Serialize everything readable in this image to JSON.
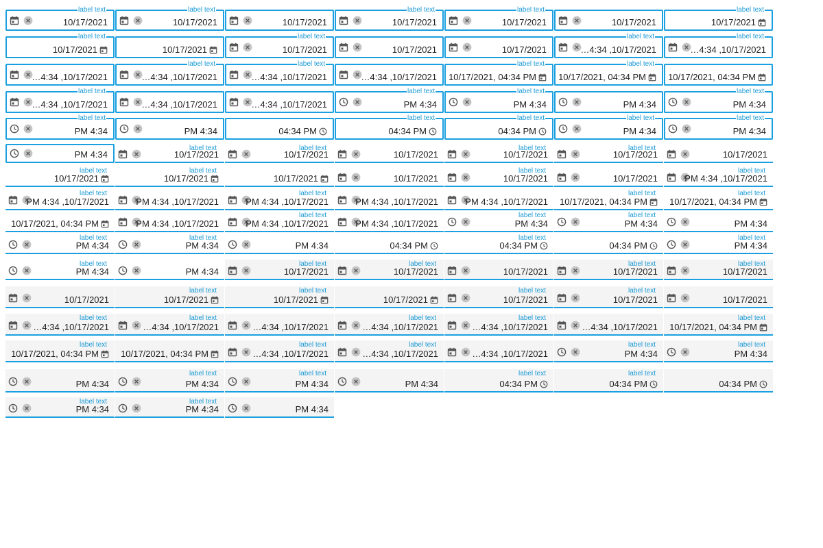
{
  "label": "label text",
  "values": {
    "date": "10/17/2021",
    "datetime_trunc": "…4:34 ,10/17/2021",
    "datetime_full": "10/17/2021, 04:34 PM",
    "datetime_rtl": "PM 4:34 ,10/17/2021",
    "time_rtl": "PM 4:34",
    "time": "04:34 PM"
  },
  "colors": {
    "accent": "#1aa0e0",
    "label": "#1a9ad6",
    "filled_bg": "#f4f4f4",
    "icon": "#555555",
    "clear_bg": "#bdbdbd"
  },
  "icons": {
    "date": "calendar-icon",
    "time": "clock-icon",
    "clear": "clear-icon"
  },
  "fields": [
    {
      "style": "outline",
      "lead": "date",
      "clear": true,
      "value": "date",
      "label": true
    },
    {
      "style": "outline",
      "lead": "date",
      "clear": true,
      "value": "date",
      "label": true
    },
    {
      "style": "outline",
      "lead": "date",
      "clear": true,
      "value": "date",
      "label": false
    },
    {
      "style": "outline",
      "lead": "date",
      "clear": true,
      "value": "date",
      "label": true
    },
    {
      "style": "outline",
      "lead": "date",
      "clear": true,
      "value": "date",
      "label": true
    },
    {
      "style": "outline",
      "lead": "date",
      "clear": true,
      "value": "date",
      "label": false
    },
    {
      "style": "outline",
      "trail": "date",
      "value": "date",
      "label": true
    },
    {
      "style": "outline",
      "trail": "date",
      "value": "date",
      "label": true
    },
    {
      "style": "outline",
      "trail": "date",
      "value": "date",
      "label": false
    },
    {
      "style": "outline",
      "lead": "date",
      "clear": true,
      "value": "date",
      "label": true
    },
    {
      "style": "outline",
      "lead": "date",
      "clear": true,
      "value": "date",
      "label": false
    },
    {
      "style": "outline",
      "lead": "date",
      "clear": true,
      "value": "date",
      "label": false
    },
    {
      "style": "outline",
      "lead": "date",
      "clear": true,
      "value": "datetime_trunc",
      "label": true
    },
    {
      "style": "outline",
      "lead": "date",
      "clear": true,
      "value": "datetime_trunc",
      "label": true
    },
    {
      "style": "outline",
      "lead": "date",
      "clear": true,
      "value": "datetime_trunc",
      "label": false
    },
    {
      "style": "outline",
      "lead": "date",
      "clear": true,
      "value": "datetime_trunc",
      "label": true
    },
    {
      "style": "outline",
      "lead": "date",
      "clear": true,
      "value": "datetime_trunc",
      "label": true
    },
    {
      "style": "outline",
      "lead": "date",
      "clear": true,
      "value": "datetime_trunc",
      "label": false
    },
    {
      "style": "outline",
      "trail": "date",
      "value": "datetime_full",
      "label": true
    },
    {
      "style": "outline",
      "trail": "date",
      "value": "datetime_full",
      "label": true
    },
    {
      "style": "outline",
      "trail": "date",
      "value": "datetime_full",
      "label": false
    },
    {
      "style": "outline",
      "lead": "date",
      "clear": true,
      "value": "datetime_trunc",
      "label": true
    },
    {
      "style": "outline",
      "lead": "date",
      "clear": true,
      "value": "datetime_trunc",
      "label": false
    },
    {
      "style": "outline",
      "lead": "date",
      "clear": true,
      "value": "datetime_trunc",
      "label": false
    },
    {
      "style": "outline",
      "lead": "time",
      "clear": true,
      "value": "time_rtl",
      "label": true
    },
    {
      "style": "outline",
      "lead": "time",
      "clear": true,
      "value": "time_rtl",
      "label": true
    },
    {
      "style": "outline",
      "lead": "time",
      "clear": true,
      "value": "time_rtl",
      "label": false
    },
    {
      "style": "outline",
      "lead": "time",
      "clear": true,
      "value": "time_rtl",
      "label": true
    },
    {
      "style": "outline",
      "lead": "time",
      "clear": true,
      "value": "time_rtl",
      "label": true
    },
    {
      "style": "outline",
      "lead": "time",
      "clear": true,
      "value": "time_rtl",
      "label": false
    },
    {
      "style": "outline",
      "trail": "time",
      "value": "time",
      "label": false
    },
    {
      "style": "outline",
      "trail": "time",
      "value": "time",
      "label": true
    },
    {
      "style": "outline",
      "trail": "time",
      "value": "time",
      "label": true
    },
    {
      "style": "outline",
      "lead": "time",
      "clear": true,
      "value": "time_rtl",
      "label": true
    },
    {
      "style": "outline",
      "lead": "time",
      "clear": true,
      "value": "time_rtl",
      "label": true
    },
    {
      "style": "outline",
      "lead": "time",
      "clear": true,
      "value": "time_rtl",
      "label": false
    },
    {
      "style": "underline",
      "lead": "date",
      "clear": true,
      "value": "date",
      "label": true
    },
    {
      "style": "underline",
      "lead": "date",
      "clear": true,
      "value": "date",
      "label": true
    },
    {
      "style": "underline",
      "lead": "date",
      "clear": true,
      "value": "date",
      "label": false
    },
    {
      "style": "underline",
      "lead": "date",
      "clear": true,
      "value": "date",
      "label": true
    },
    {
      "style": "underline",
      "lead": "date",
      "clear": true,
      "value": "date",
      "label": true
    },
    {
      "style": "underline",
      "lead": "date",
      "clear": true,
      "value": "date",
      "label": false
    },
    {
      "style": "underline",
      "trail": "date",
      "value": "date",
      "label": true
    },
    {
      "style": "underline",
      "trail": "date",
      "value": "date",
      "label": true
    },
    {
      "style": "underline",
      "trail": "date",
      "value": "date",
      "label": false
    },
    {
      "style": "underline",
      "lead": "date",
      "clear": true,
      "value": "date",
      "label": false
    },
    {
      "style": "underline",
      "lead": "date",
      "clear": true,
      "value": "date",
      "label": true
    },
    {
      "style": "underline",
      "lead": "date",
      "clear": true,
      "value": "date",
      "label": false
    },
    {
      "style": "underline",
      "lead": "date",
      "clear": true,
      "value": "datetime_rtl",
      "label": true
    },
    {
      "style": "underline",
      "lead": "date",
      "clear": true,
      "value": "datetime_rtl",
      "label": true
    },
    {
      "style": "underline",
      "lead": "date",
      "clear": true,
      "value": "datetime_rtl",
      "label": false
    },
    {
      "style": "underline",
      "lead": "date",
      "clear": true,
      "value": "datetime_rtl",
      "label": true
    },
    {
      "style": "underline",
      "lead": "date",
      "clear": true,
      "value": "datetime_rtl",
      "label": false
    },
    {
      "style": "underline",
      "lead": "date",
      "clear": true,
      "value": "datetime_rtl",
      "label": false
    },
    {
      "style": "underline",
      "trail": "date",
      "value": "datetime_full",
      "label": true
    },
    {
      "style": "underline",
      "trail": "date",
      "value": "datetime_full",
      "label": true
    },
    {
      "style": "underline",
      "trail": "date",
      "value": "datetime_full",
      "label": false
    },
    {
      "style": "underline",
      "lead": "date",
      "clear": true,
      "value": "datetime_rtl",
      "label": false
    },
    {
      "style": "underline",
      "lead": "date",
      "clear": true,
      "value": "datetime_rtl",
      "label": true
    },
    {
      "style": "underline",
      "lead": "date",
      "clear": true,
      "value": "datetime_rtl",
      "label": false
    },
    {
      "style": "underline",
      "lead": "time",
      "clear": true,
      "value": "time_rtl",
      "label": true
    },
    {
      "style": "underline",
      "lead": "time",
      "clear": true,
      "value": "time_rtl",
      "label": true
    },
    {
      "style": "underline",
      "lead": "time",
      "clear": true,
      "value": "time_rtl",
      "label": false
    },
    {
      "style": "underline",
      "lead": "time",
      "clear": true,
      "value": "time_rtl",
      "label": true
    },
    {
      "style": "underline",
      "lead": "time",
      "clear": true,
      "value": "time_rtl",
      "label": true
    },
    {
      "style": "underline",
      "lead": "time",
      "clear": true,
      "value": "time_rtl",
      "label": false
    },
    {
      "style": "underline",
      "trail": "time",
      "value": "time",
      "label": false
    },
    {
      "style": "underline",
      "trail": "time",
      "value": "time",
      "label": true
    },
    {
      "style": "underline",
      "trail": "time",
      "value": "time",
      "label": false
    },
    {
      "style": "underline",
      "lead": "time",
      "clear": true,
      "value": "time_rtl",
      "label": true
    },
    {
      "style": "underline",
      "lead": "time",
      "clear": true,
      "value": "time_rtl",
      "label": true
    },
    {
      "style": "underline",
      "lead": "time",
      "clear": true,
      "value": "time_rtl",
      "label": false
    },
    {
      "style": "filled",
      "lead": "date",
      "clear": true,
      "value": "date",
      "label": true
    },
    {
      "style": "filled",
      "lead": "date",
      "clear": true,
      "value": "date",
      "label": true
    },
    {
      "style": "filled",
      "lead": "date",
      "clear": true,
      "value": "date",
      "label": false
    },
    {
      "style": "filled",
      "lead": "date",
      "clear": true,
      "value": "date",
      "label": true
    },
    {
      "style": "filled",
      "lead": "date",
      "clear": true,
      "value": "date",
      "label": true
    },
    {
      "style": "filled",
      "lead": "date",
      "clear": true,
      "value": "date",
      "label": false
    },
    {
      "style": "filled",
      "trail": "date",
      "value": "date",
      "label": true
    },
    {
      "style": "filled",
      "trail": "date",
      "value": "date",
      "label": true
    },
    {
      "style": "filled",
      "trail": "date",
      "value": "date",
      "label": false
    },
    {
      "style": "filled",
      "lead": "date",
      "clear": true,
      "value": "date",
      "label": true
    },
    {
      "style": "filled",
      "lead": "date",
      "clear": true,
      "value": "date",
      "label": true
    },
    {
      "style": "filled",
      "lead": "date",
      "clear": true,
      "value": "date",
      "label": false
    },
    {
      "style": "filled",
      "lead": "date",
      "clear": true,
      "value": "datetime_trunc",
      "label": true
    },
    {
      "style": "filled",
      "lead": "date",
      "clear": true,
      "value": "datetime_trunc",
      "label": true
    },
    {
      "style": "filled",
      "lead": "date",
      "clear": true,
      "value": "datetime_trunc",
      "label": false
    },
    {
      "style": "filled",
      "lead": "date",
      "clear": true,
      "value": "datetime_trunc",
      "label": true
    },
    {
      "style": "filled",
      "lead": "date",
      "clear": true,
      "value": "datetime_trunc",
      "label": true
    },
    {
      "style": "filled",
      "lead": "date",
      "clear": true,
      "value": "datetime_trunc",
      "label": false
    },
    {
      "style": "filled",
      "trail": "date",
      "value": "datetime_full",
      "label": true
    },
    {
      "style": "filled",
      "trail": "date",
      "value": "datetime_full",
      "label": true
    },
    {
      "style": "filled",
      "trail": "date",
      "value": "datetime_full",
      "label": false
    },
    {
      "style": "filled",
      "lead": "date",
      "clear": true,
      "value": "datetime_trunc",
      "label": true
    },
    {
      "style": "filled",
      "lead": "date",
      "clear": true,
      "value": "datetime_trunc",
      "label": true
    },
    {
      "style": "filled",
      "lead": "date",
      "clear": true,
      "value": "datetime_trunc",
      "label": false
    },
    {
      "style": "filled",
      "lead": "time",
      "clear": true,
      "value": "time_rtl",
      "label": true
    },
    {
      "style": "filled",
      "lead": "time",
      "clear": true,
      "value": "time_rtl",
      "label": true
    },
    {
      "style": "filled",
      "lead": "time",
      "clear": true,
      "value": "time_rtl",
      "label": false
    },
    {
      "style": "filled",
      "lead": "time",
      "clear": true,
      "value": "time_rtl",
      "label": true
    },
    {
      "style": "filled",
      "lead": "time",
      "clear": true,
      "value": "time_rtl",
      "label": true
    },
    {
      "style": "filled",
      "lead": "time",
      "clear": true,
      "value": "time_rtl",
      "label": false
    },
    {
      "style": "filled",
      "trail": "time",
      "value": "time",
      "label": true
    },
    {
      "style": "filled",
      "trail": "time",
      "value": "time",
      "label": true
    },
    {
      "style": "filled",
      "trail": "time",
      "value": "time",
      "label": false
    },
    {
      "style": "filled",
      "lead": "time",
      "clear": true,
      "value": "time_rtl",
      "label": true
    },
    {
      "style": "filled",
      "lead": "time",
      "clear": true,
      "value": "time_rtl",
      "label": true
    },
    {
      "style": "filled",
      "lead": "time",
      "clear": true,
      "value": "time_rtl",
      "label": false
    }
  ]
}
